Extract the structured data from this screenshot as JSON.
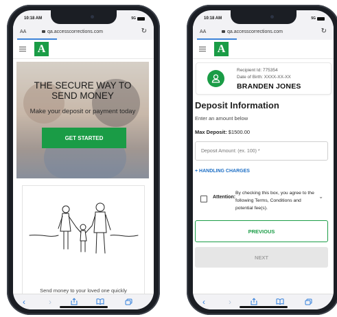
{
  "left": {
    "status": {
      "time": "10:18 AM",
      "network": "5G"
    },
    "browser": {
      "text_size": "AA",
      "url": "qa.accesscorrections.com"
    },
    "logo": {
      "letter": "A"
    },
    "hero": {
      "title": "THE SECURE WAY TO SEND MONEY",
      "subtitle": "Make your deposit or payment today",
      "cta_label": "GET STARTED"
    },
    "card": {
      "text": "Send money to your loved one quickly"
    }
  },
  "right": {
    "status": {
      "time": "10:18 AM",
      "network": "5G"
    },
    "browser": {
      "text_size": "AA",
      "url": "qa.accesscorrections.com"
    },
    "logo": {
      "letter": "A"
    },
    "recipient": {
      "id_line": "Recipient Id: 775354",
      "dob_line": "Date of Birth: XXXX-XX-XX",
      "name": "BRANDEN JONES"
    },
    "deposit": {
      "title": "Deposit Information",
      "subtitle": "Enter an amount below",
      "max_label": "Max Deposit:",
      "max_value": "$1500.00",
      "amount_placeholder": "Deposit Amount: (ex. 100) *",
      "handling_link": "+ HANDLING CHARGES",
      "attention_label": "Attention:",
      "attention_text": "By checking this box, you agree to the following Terms, Conditions and potential fee(s).",
      "previous_label": "PREVIOUS",
      "next_label": "NEXT"
    }
  },
  "colors": {
    "brand_green": "#1a9c46",
    "link_blue": "#1e6fc5",
    "safari_blue": "#2f7ddb"
  },
  "icons": [
    "menu-icon",
    "lock-icon",
    "reload-icon",
    "back-icon",
    "forward-icon",
    "share-icon",
    "bookmarks-icon",
    "tabs-icon",
    "user-icon",
    "chevron-down-icon"
  ]
}
